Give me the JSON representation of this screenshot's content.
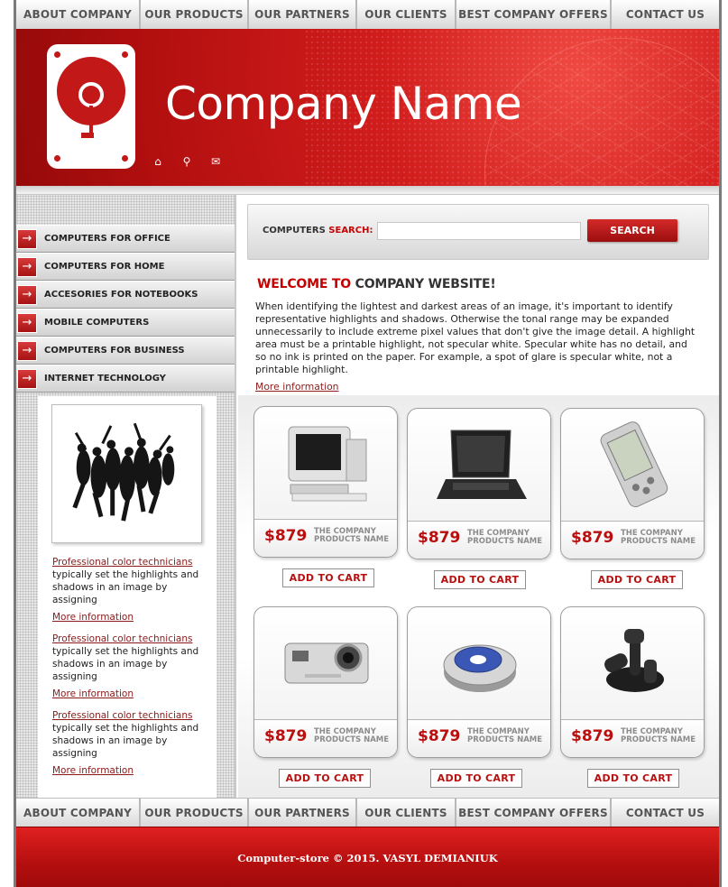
{
  "nav": {
    "items": [
      "ABOUT COMPANY",
      "OUR PRODUCTS",
      "OUR PARTNERS",
      "OUR CLIENTS",
      "BEST COMPANY OFFERS",
      "CONTACT US"
    ]
  },
  "header": {
    "company_name": "Company Name",
    "icons": [
      "home-icon",
      "search-icon",
      "mail-icon"
    ]
  },
  "sidebar": {
    "menu": [
      "COMPUTERS FOR OFFICE",
      "COMPUTERS FOR HOME",
      "ACCESORIES FOR NOTEBOOKS",
      "MOBILE COMPUTERS",
      "COMPUTERS FOR BUSINESS",
      "INTERNET TECHNOLOGY"
    ],
    "news": [
      {
        "title": "Professional color technicians",
        "text": "typically set the highlights and shadows in an image by assigning",
        "more": "More information"
      },
      {
        "title": "Professional color technicians",
        "text": "typically set the highlights and shadows in an image by assigning",
        "more": "More information"
      },
      {
        "title": "Professional color technicians",
        "text": "typically set the highlights and shadows in an image by assigning",
        "more": "More information"
      }
    ]
  },
  "search": {
    "label": "COMPUTERS",
    "label_red": "SEARCH:",
    "value": "",
    "button": "SEARCH"
  },
  "welcome": {
    "red": "WELCOME TO",
    "rest": "COMPANY WEBSITE!",
    "text": "When identifying the lightest and darkest areas of an image, it's important to identify representative highlights and shadows. Otherwise the tonal range may be expanded unnecessarily to include extreme pixel values that don't give the image detail. A highlight area must be a printable highlight, not specular white. Specular white has no detail, and so no ink is printed on the paper. For example, a spot of glare is specular white, not a printable highlight.",
    "more": "More information"
  },
  "products": [
    {
      "price": "$879",
      "name": "THE COMPANY PRODUCTS NAME",
      "cart": "ADD TO CART",
      "icon": "desktop-computer-icon"
    },
    {
      "price": "$879",
      "name": "THE COMPANY PRODUCTS NAME",
      "cart": "ADD TO CART",
      "icon": "laptop-icon"
    },
    {
      "price": "$879",
      "name": "THE COMPANY PRODUCTS NAME",
      "cart": "ADD TO CART",
      "icon": "pda-icon"
    },
    {
      "price": "$879",
      "name": "THE COMPANY PRODUCTS NAME",
      "cart": "ADD TO CART",
      "icon": "digital-camera-icon"
    },
    {
      "price": "$879",
      "name": "THE COMPANY PRODUCTS NAME",
      "cart": "ADD TO CART",
      "icon": "cd-player-icon"
    },
    {
      "price": "$879",
      "name": "THE COMPANY PRODUCTS NAME",
      "cart": "ADD TO CART",
      "icon": "joystick-icon"
    }
  ],
  "footer": {
    "copyright": "Computer-store © 2015. VASYL DEMIANIUK"
  },
  "colors": {
    "accent": "#c40000",
    "header_red": "#d11c1c"
  }
}
